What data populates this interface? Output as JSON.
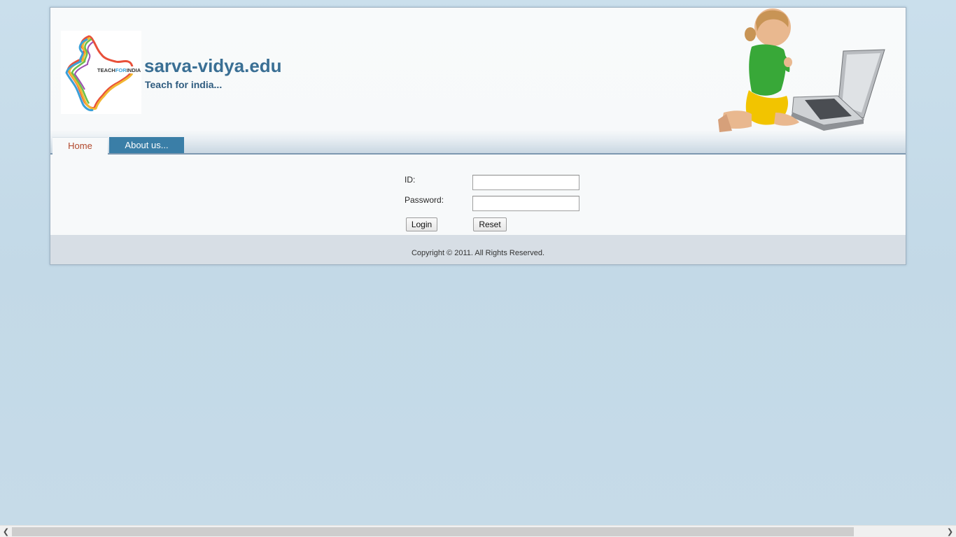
{
  "header": {
    "site_title": "sarva-vidya.edu",
    "tagline": "Teach for india...",
    "logo_text_1": "TEACH",
    "logo_text_2": "FOR",
    "logo_text_3": "INDIA"
  },
  "nav": {
    "tabs": [
      {
        "label": "Home",
        "active": true
      },
      {
        "label": "About us...",
        "active": false
      }
    ]
  },
  "login_form": {
    "id_label": "ID:",
    "id_value": "",
    "password_label": "Password:",
    "password_value": "",
    "login_button": "Login",
    "reset_button": "Reset"
  },
  "footer": {
    "copyright": "Copyright © 2011. All Rights Reserved."
  },
  "colors": {
    "page_bg": "#c5dbe9",
    "title": "#3a6f94",
    "tab_active_text": "#b1472b",
    "tab_inactive_bg": "#3a7ea7",
    "footer_bg": "#d7dee5"
  },
  "scrollbar": {
    "left_icon": "chevron-left-icon",
    "right_icon": "chevron-right-icon"
  }
}
